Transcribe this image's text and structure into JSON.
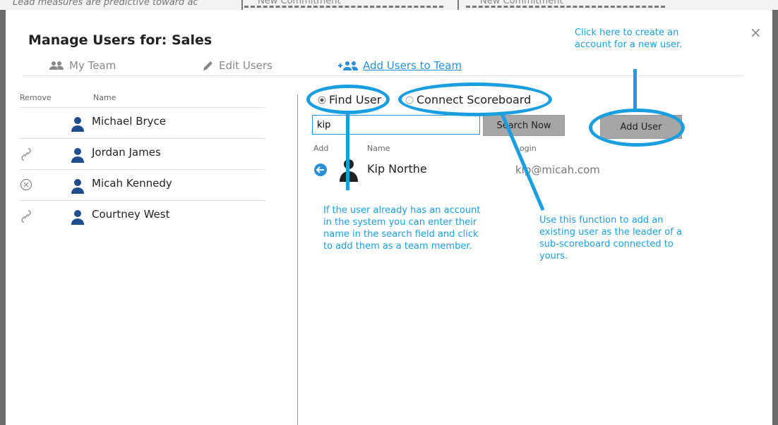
{
  "background": {
    "strip_text": "Lead measures are predictive toward ac",
    "commit1": "New Commitment",
    "commit2": "New Commitment"
  },
  "modal": {
    "title": "Manage Users for: Sales",
    "close": "×"
  },
  "tabs": [
    {
      "label": "My Team",
      "icon": "people-icon"
    },
    {
      "label": "Edit Users",
      "icon": "pencil-icon"
    },
    {
      "label": "Add Users to Team",
      "icon": "add-people-icon"
    }
  ],
  "team_list": {
    "col_remove": "Remove",
    "col_name": "Name",
    "users": [
      {
        "name": "Michael Bryce",
        "action": ""
      },
      {
        "name": "Jordan James",
        "action": "unlink-icon"
      },
      {
        "name": "Micah Kennedy",
        "action": "remove-icon"
      },
      {
        "name": "Courtney West",
        "action": "unlink-icon"
      }
    ]
  },
  "add_panel": {
    "radio_find": "Find User",
    "radio_connect": "Connect Scoreboard",
    "search_value": "kip",
    "search_button": "Search Now",
    "add_user_button": "Add User",
    "col_add": "Add",
    "col_name": "Name",
    "col_login": "Login",
    "result": {
      "name": "Kip Northe",
      "login": "kip@micah.com"
    }
  },
  "annotations": {
    "add_user_note": "Click here to create an account for a new user.",
    "find_user_note": "If the user already has an account in the system you can enter their name in the search field and click to add them as a team member.",
    "connect_note": "Use this function to add an existing user as the leader of a sub-scoreboard connected to yours."
  },
  "colors": {
    "accent": "#2b8fd6",
    "annotation": "#1a9ee0"
  }
}
